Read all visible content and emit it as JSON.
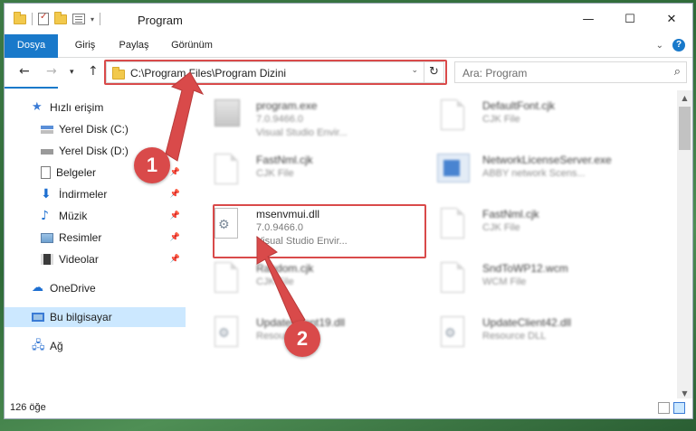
{
  "window": {
    "title": "Program",
    "controls": {
      "minimize": "—",
      "maximize": "☐",
      "close": "✕"
    }
  },
  "ribbon": {
    "tabs": [
      "Dosya",
      "Giriş",
      "Paylaş",
      "Görünüm"
    ]
  },
  "navbar": {
    "address": "C:\\Program Files\\Program Dizini",
    "search_placeholder": "Ara: Program"
  },
  "sidebar": {
    "items": [
      {
        "label": "Hızlı erişim",
        "icon": "star-icon"
      },
      {
        "label": "Yerel Disk (C:)",
        "icon": "disk-icon",
        "pinned": true
      },
      {
        "label": "Yerel Disk (D:)",
        "icon": "disk-icon",
        "pinned": true
      },
      {
        "label": "Belgeler",
        "icon": "documents-icon",
        "pinned": true
      },
      {
        "label": "İndirmeler",
        "icon": "download-icon",
        "pinned": true
      },
      {
        "label": "Müzik",
        "icon": "music-icon",
        "pinned": true
      },
      {
        "label": "Resimler",
        "icon": "pictures-icon",
        "pinned": true
      },
      {
        "label": "Videolar",
        "icon": "videos-icon",
        "pinned": true
      },
      {
        "label": "OneDrive",
        "icon": "cloud-icon"
      },
      {
        "label": "Bu bilgisayar",
        "icon": "computer-icon",
        "selected": true
      },
      {
        "label": "Ağ",
        "icon": "network-icon"
      }
    ]
  },
  "files": [
    {
      "name": "program.exe",
      "line1": "7.0.9466.0",
      "line2": "Visual Studio Envir...",
      "icon": "exe-icon"
    },
    {
      "name": "DefaultFont.cjk",
      "line1": "CJK File",
      "icon": "file-icon"
    },
    {
      "name": "FastNml.cjk",
      "line1": "CJK File",
      "icon": "file-icon"
    },
    {
      "name": "NetworkLicenseServer.exe",
      "line1": "ABBY network Scens...",
      "icon": "app-icon"
    },
    {
      "name": "msenvmui.dll",
      "line1": "7.0.9466.0",
      "line2": "Visual Studio Envir...",
      "icon": "dll-icon"
    },
    {
      "name": "FastNml.cjk",
      "line1": "CJK File",
      "icon": "file-icon"
    },
    {
      "name": "Random.cjk",
      "line1": "CJK File",
      "icon": "file-icon"
    },
    {
      "name": "SndToWP12.wcm",
      "line1": "WCM File",
      "icon": "file-icon"
    },
    {
      "name": "UpdateClient19.dll",
      "line1": "Resource DLL",
      "icon": "dll-icon"
    },
    {
      "name": "UpdateClient42.dll",
      "line1": "Resource DLL",
      "icon": "dll-icon"
    }
  ],
  "status": {
    "item_count": "126 öğe"
  },
  "annotations": {
    "step1": "1",
    "step2": "2"
  },
  "colors": {
    "accent": "#1979ca",
    "highlight": "#d94a4a",
    "selection": "#cce8ff"
  }
}
